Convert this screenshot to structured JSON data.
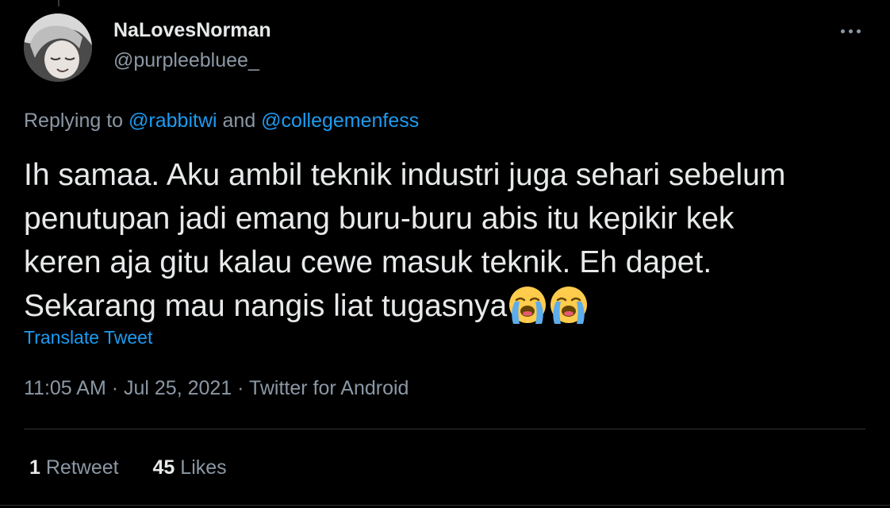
{
  "author": {
    "display_name": "NaLovesNorman",
    "handle": "@purpleebluee_",
    "avatar_icon": "anime-avatar"
  },
  "reply": {
    "prefix": "Replying to ",
    "mention1": "@rabbitwi",
    "joiner": " and ",
    "mention2": "@collegemenfess"
  },
  "tweet": {
    "lines": [
      "Ih samaa. Aku ambil teknik industri juga sehari sebelum",
      "penutupan jadi emang buru-buru abis itu kepikir kek",
      "keren aja gitu kalau cewe masuk teknik. Eh dapet.",
      "Sekarang mau nangis liat tugasnya"
    ],
    "trailing_emoji": [
      "loudly-crying-face",
      "loudly-crying-face"
    ]
  },
  "translate_label": "Translate Tweet",
  "meta": "11:05 AM · Jul 25, 2021 · Twitter for Android",
  "stats": {
    "retweets_count": "1",
    "retweets_label": "Retweet",
    "likes_count": "45",
    "likes_label": "Likes"
  },
  "colors": {
    "background": "#000000",
    "text_primary": "#e7e9ea",
    "text_secondary": "#8b98a5",
    "link": "#1d9bf0",
    "divider": "#2f3336"
  },
  "icons": {
    "more": "more-horizontal-icon"
  }
}
